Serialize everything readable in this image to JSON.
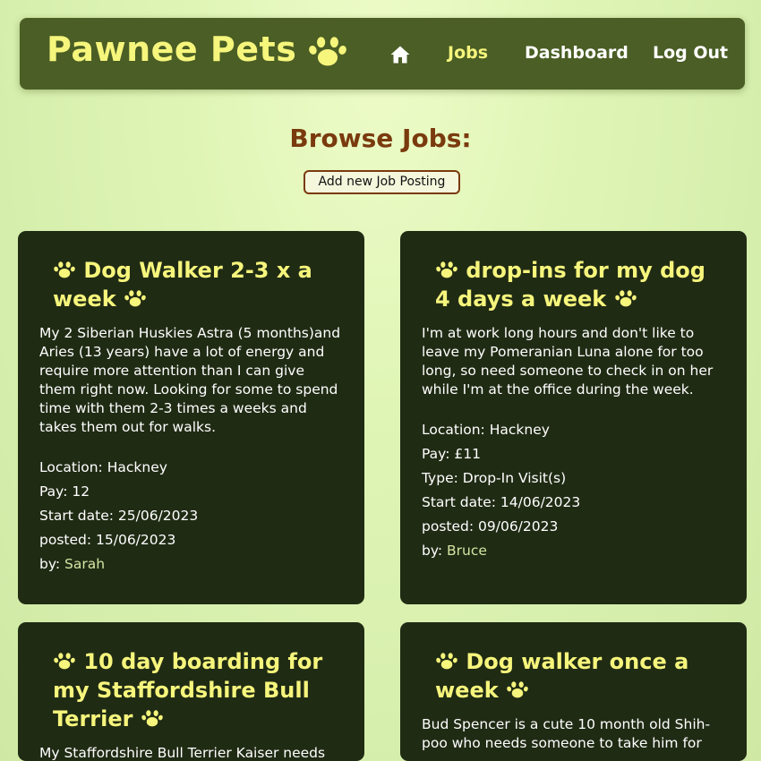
{
  "header": {
    "brand": "Pawnee Pets",
    "nav": {
      "home_icon": "home-icon",
      "jobs": "Jobs",
      "dashboard": "Dashboard",
      "logout": "Log Out"
    }
  },
  "main": {
    "title": "Browse Jobs:",
    "add_button": "Add new Job Posting"
  },
  "jobs": [
    {
      "title": "Dog Walker 2-3 x a week",
      "description": "My 2 Siberian Huskies Astra (5 months)and Aries (13 years) have a lot of energy and require more attention than I can give them right now. Looking for some to spend time with them 2-3 times a weeks and takes them out for walks.",
      "location_label": "Location:",
      "location": "Hackney",
      "pay_label": "Pay:",
      "pay": "12",
      "start_label": "Start date:",
      "start_date": "25/06/2023",
      "posted_label": "posted:",
      "posted": "15/06/2023",
      "by_label": "by:",
      "author": "Sarah"
    },
    {
      "title": "drop-ins for my dog 4 days a week",
      "description": "I'm at work long hours and don't like to leave my Pomeranian Luna alone for too long, so need someone to check in on her while I'm at the office during the week.",
      "location_label": "Location:",
      "location": "Hackney",
      "pay_label": "Pay:",
      "pay": "£11",
      "type_label": "Type:",
      "type": "Drop-In Visit(s)",
      "start_label": "Start date:",
      "start_date": "14/06/2023",
      "posted_label": "posted:",
      "posted": "09/06/2023",
      "by_label": "by:",
      "author": "Bruce"
    },
    {
      "title": "10 day boarding for my Staffordshire Bull Terrier",
      "description": "My Staffordshire Bull Terrier Kaiser needs"
    },
    {
      "title": "Dog walker once a week",
      "description": "Bud Spencer is a cute 10 month old Shih-poo who needs someone to take him for"
    }
  ],
  "colors": {
    "navbar": "#4a5e25",
    "brand_yellow": "#f6f57c",
    "card_bg": "#202b14",
    "title_brown": "#7a3a0e",
    "author_link": "#d5e5a3"
  }
}
